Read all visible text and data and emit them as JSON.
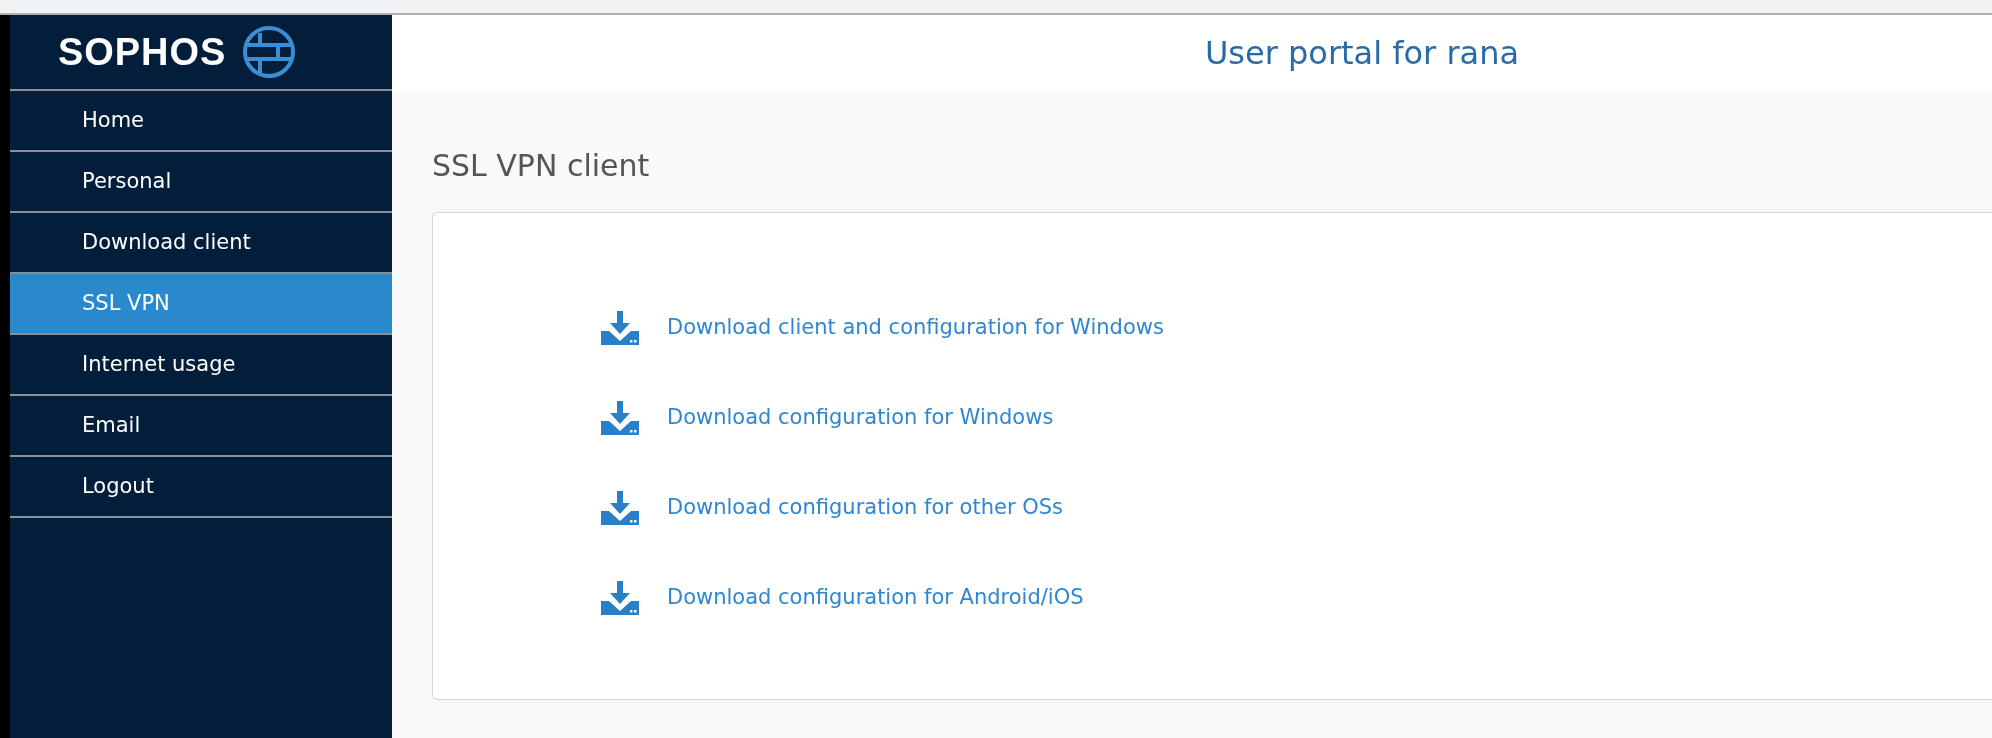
{
  "logo": {
    "text": "SOPHOS"
  },
  "header": {
    "title": "User portal for rana"
  },
  "sidebar": {
    "items": [
      {
        "label": "Home",
        "selected": false
      },
      {
        "label": "Personal",
        "selected": false
      },
      {
        "label": "Download client",
        "selected": false
      },
      {
        "label": "SSL VPN",
        "selected": true
      },
      {
        "label": "Internet usage",
        "selected": false
      },
      {
        "label": "Email",
        "selected": false
      },
      {
        "label": "Logout",
        "selected": false
      }
    ]
  },
  "page": {
    "title": "SSL VPN client",
    "links": [
      "Download client and configuration for Windows",
      "Download configuration for Windows",
      "Download configuration for other OSs",
      "Download configuration for Android/iOS"
    ]
  }
}
